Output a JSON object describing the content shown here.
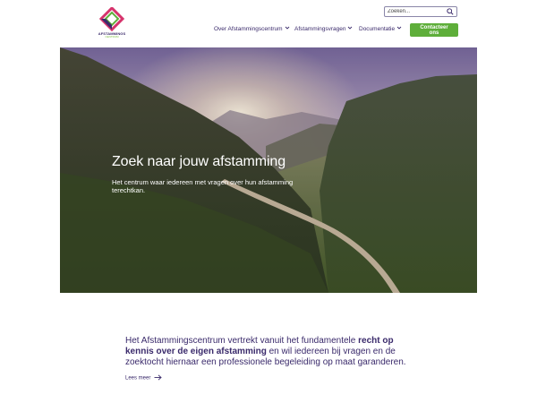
{
  "brand": {
    "name": "AFSTAMMINGS",
    "sub": "CENTRUM",
    "colors": {
      "purple": "#3a2a6b",
      "pink": "#d6336c",
      "green": "#5eae3a"
    }
  },
  "search": {
    "placeholder": "Zoeken...",
    "value": "",
    "icon": "search-icon"
  },
  "nav": {
    "items": [
      {
        "label": "Over Afstammingscentrum",
        "icon": "chevron-down-icon"
      },
      {
        "label": "Afstammingsvragen",
        "icon": "chevron-down-icon"
      },
      {
        "label": "Documentatie",
        "icon": "chevron-down-icon"
      }
    ],
    "contact_label": "Contacteer ons"
  },
  "hero": {
    "title": "Zoek naar jouw afstamming",
    "subtitle": "Het centrum waar iedereen met vragen over hun afstamming terechtkan."
  },
  "intro": {
    "text_before": "Het Afstammingscentrum vertrekt vanuit het fundamentele ",
    "text_bold": "recht op kennis over de eigen afstamming",
    "text_after": " en wil iedereen bij vragen en de zoektocht hiernaar een professionele begeleiding op maat garanderen.",
    "read_more": "Lees meer",
    "read_more_icon": "arrow-right-icon"
  }
}
